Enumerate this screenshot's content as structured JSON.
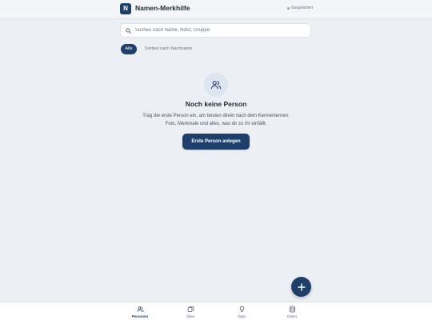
{
  "header": {
    "logo_letter": "N",
    "title": "Namen-Merkhilfe",
    "status": "Gespeichert"
  },
  "search": {
    "placeholder": "Suchen nach Name, Notiz, Gruppe",
    "value": ""
  },
  "filters": {
    "all_label": "Alle",
    "sort_label": "Sortiert nach Nachname"
  },
  "empty_state": {
    "icon": "people-icon",
    "title": "Noch keine Person",
    "line1": "Trag die erste Person ein, am besten direkt nach dem Kennenlernen.",
    "line2": "Foto, Merkmale und alles, was dir zu ihr einfällt.",
    "button_label": "Erste Person anlegen"
  },
  "fab": {
    "icon": "plus-icon"
  },
  "bottom_nav": {
    "items": [
      {
        "label": "Personen",
        "icon": "people-icon",
        "active": true
      },
      {
        "label": "Üben",
        "icon": "cards-icon",
        "active": false
      },
      {
        "label": "Tipps",
        "icon": "lightbulb-icon",
        "active": false
      },
      {
        "label": "Daten",
        "icon": "database-icon",
        "active": false
      }
    ]
  },
  "colors": {
    "accent": "#1f3f6b",
    "background": "#eceff3",
    "icon_circle": "#dde6f0"
  }
}
